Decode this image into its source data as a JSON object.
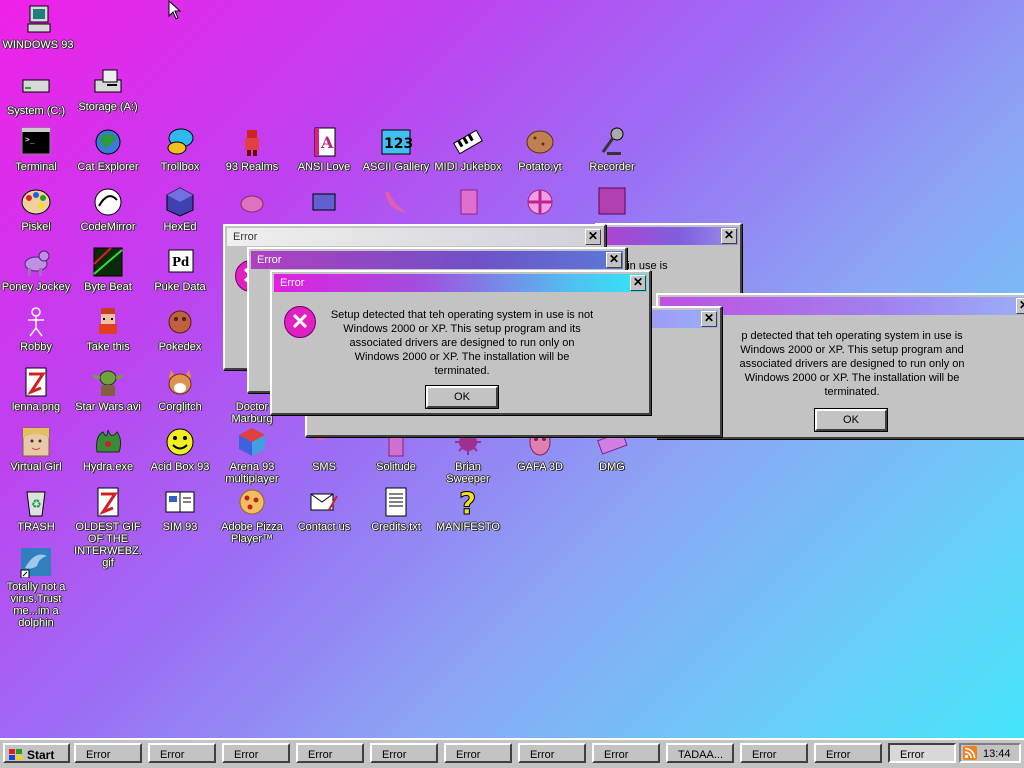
{
  "desktop": {
    "icons": [
      {
        "label": "WINDOWS 93",
        "icon": "computer-icon"
      },
      {
        "label": "System (C:)",
        "icon": "drive-icon"
      },
      {
        "label": "Storage (A:)",
        "icon": "floppy-drive-icon"
      },
      {
        "label": "Terminal",
        "icon": "terminal-icon"
      },
      {
        "label": "Cat Explorer",
        "icon": "cat-globe-icon"
      },
      {
        "label": "Trollbox",
        "icon": "chat-bubble-icon"
      },
      {
        "label": "93 Realms",
        "icon": "realms-icon"
      },
      {
        "label": "ANSI Love",
        "icon": "ansi-letter-icon"
      },
      {
        "label": "ASCII Gallery",
        "icon": "ascii-123-icon"
      },
      {
        "label": "MIDI Jukebox",
        "icon": "piano-keys-icon"
      },
      {
        "label": "Potato.yt",
        "icon": "potato-icon"
      },
      {
        "label": "Recorder",
        "icon": "microphone-icon"
      },
      {
        "label": "Piskel",
        "icon": "palette-icon"
      },
      {
        "label": "CodeMirror",
        "icon": "codemirror-icon"
      },
      {
        "label": "HexEd",
        "icon": "hex-cube-icon"
      },
      {
        "label": "Poney Jockey",
        "icon": "pony-icon"
      },
      {
        "label": "Byte Beat",
        "icon": "bytebeat-icon"
      },
      {
        "label": "Puke Data",
        "icon": "pd-icon"
      },
      {
        "label": "Robby",
        "icon": "stick-figure-icon"
      },
      {
        "label": "Take this",
        "icon": "pixel-character-icon"
      },
      {
        "label": "Pokedex",
        "icon": "pokedex-icon"
      },
      {
        "label": "lenna.png",
        "icon": "image-file-icon"
      },
      {
        "label": "Star Wars.avi",
        "icon": "yoda-icon"
      },
      {
        "label": "Corglitch",
        "icon": "corgi-icon"
      },
      {
        "label": "Doctor Marburg",
        "icon": "doctor-icon"
      },
      {
        "label": "Virtual Girl",
        "icon": "virtual-girl-icon"
      },
      {
        "label": "Hydra.exe",
        "icon": "hydra-icon"
      },
      {
        "label": "Acid Box 93",
        "icon": "smiley-icon"
      },
      {
        "label": "Arena 93 multiplayer",
        "icon": "arena-cube-icon"
      },
      {
        "label": "SMS",
        "icon": "sms-icon"
      },
      {
        "label": "Solitude",
        "icon": "solitude-icon"
      },
      {
        "label": "Brian Sweeper",
        "icon": "mine-icon"
      },
      {
        "label": "GAFA 3D",
        "icon": "face-icon"
      },
      {
        "label": "DMG",
        "icon": "dmg-icon"
      },
      {
        "label": "TRASH",
        "icon": "recycle-bin-icon"
      },
      {
        "label": "OLDEST GIF OF THE INTERWEBZ.gif",
        "icon": "gif-file-icon"
      },
      {
        "label": "SIM 93",
        "icon": "sim-book-icon"
      },
      {
        "label": "Adobe Pizza Player™",
        "icon": "pizza-icon"
      },
      {
        "label": "Contact us",
        "icon": "contact-icon"
      },
      {
        "label": "Credits.txt",
        "icon": "text-file-icon"
      },
      {
        "label": "MANIFESTO",
        "icon": "question-mark-icon"
      },
      {
        "label": "Totally not a virus.Trust me...im a dolphin",
        "icon": "dolphin-icon"
      }
    ]
  },
  "dialogs": {
    "title": "Error",
    "message": "Setup detected that teh operating system in use is not Windows 2000 or XP. This setup program and its associated drivers are designed to run only on Windows 2000 or XP. The installation will be terminated.",
    "partial_message": "p detected that teh operating system in use is Windows 2000 or XP. This setup program and associated drivers are designed to run only on Windows 2000 or XP. The installation will be terminated.",
    "fragment_1": "m in use is",
    "fragment_2": "m and",
    "fragment_3": "nly on",
    "ok_label": "OK",
    "close_glyph": "✕"
  },
  "taskbar": {
    "start_label": "Start",
    "buttons": [
      "Error",
      "Error",
      "Error",
      "Error",
      "Error",
      "Error",
      "Error",
      "Error",
      "TADAA...",
      "Error",
      "Error",
      "Error"
    ],
    "clock": "13:44"
  },
  "colors": {
    "accent_magenta": "#f020e8",
    "accent_cyan": "#40e8fa",
    "window_gray": "#c3c3c3"
  }
}
